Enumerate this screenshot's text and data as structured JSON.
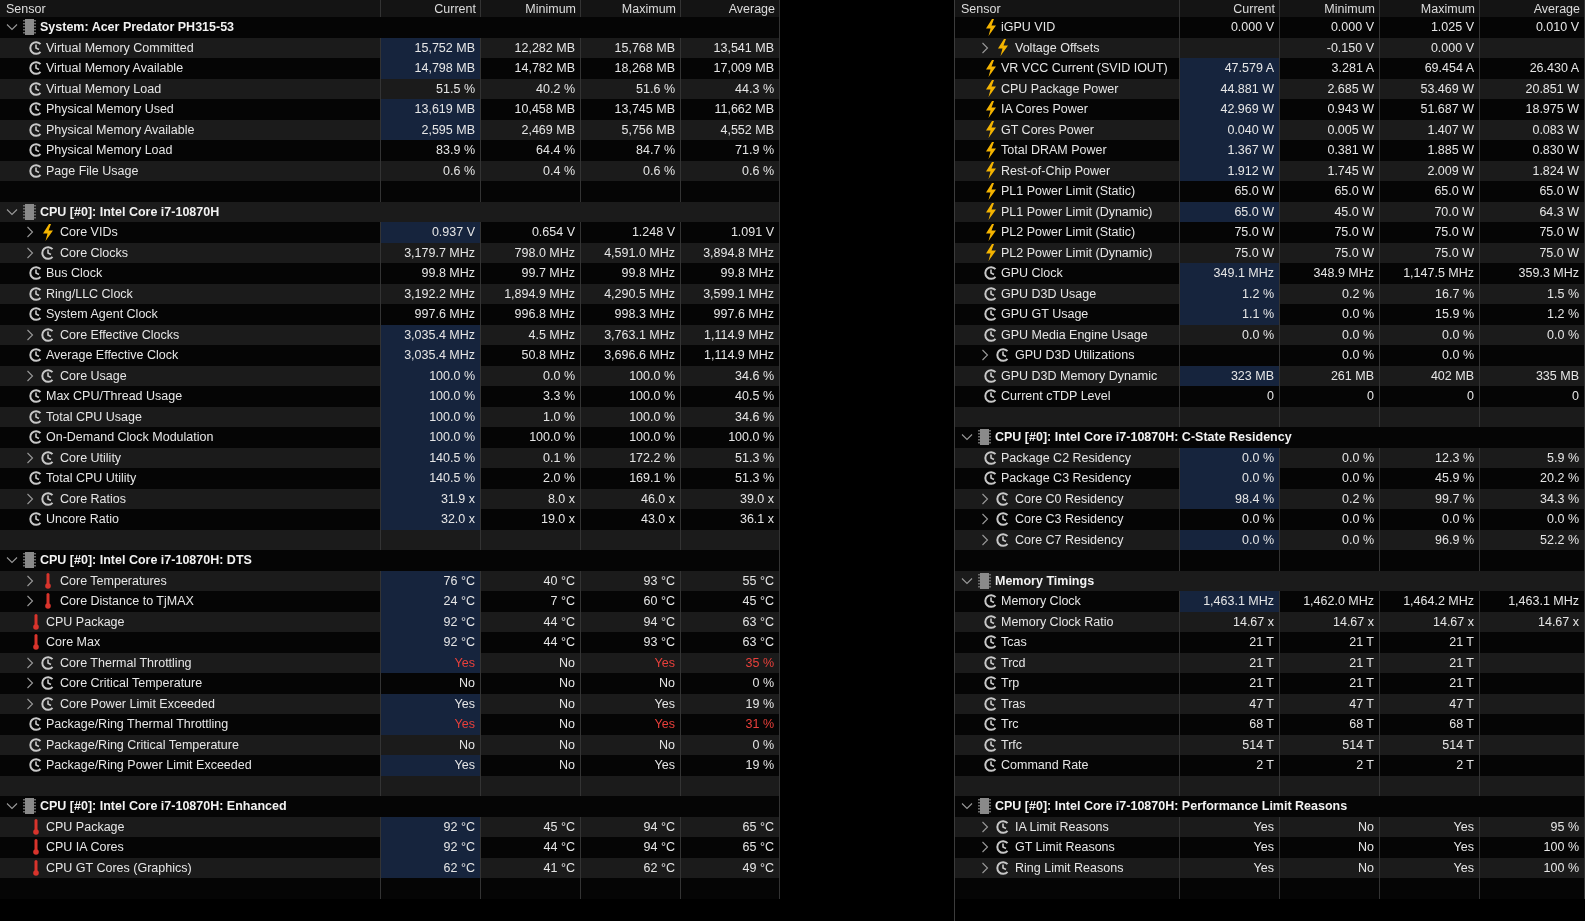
{
  "left_panel": {
    "columns": [
      "Sensor",
      "Current",
      "Minimum",
      "Maximum",
      "Average"
    ],
    "groups": [
      {
        "title": "System: Acer Predator PH315-53",
        "expanded": true,
        "sensors": [
          {
            "label": "Virtual Memory Committed",
            "kind": "clock",
            "expandable": false,
            "highlighted": true,
            "current": "15,752 MB",
            "minimum": "12,282 MB",
            "maximum": "15,768 MB",
            "average": "13,541 MB"
          },
          {
            "label": "Virtual Memory Available",
            "kind": "clock",
            "expandable": false,
            "highlighted": true,
            "current": "14,798 MB",
            "minimum": "14,782 MB",
            "maximum": "18,268 MB",
            "average": "17,009 MB"
          },
          {
            "label": "Virtual Memory Load",
            "kind": "clock",
            "expandable": false,
            "highlighted": false,
            "current": "51.5 %",
            "minimum": "40.2 %",
            "maximum": "51.6 %",
            "average": "44.3 %"
          },
          {
            "label": "Physical Memory Used",
            "kind": "clock",
            "expandable": false,
            "highlighted": true,
            "current": "13,619 MB",
            "minimum": "10,458 MB",
            "maximum": "13,745 MB",
            "average": "11,662 MB"
          },
          {
            "label": "Physical Memory Available",
            "kind": "clock",
            "expandable": false,
            "highlighted": true,
            "current": "2,595 MB",
            "minimum": "2,469 MB",
            "maximum": "5,756 MB",
            "average": "4,552 MB"
          },
          {
            "label": "Physical Memory Load",
            "kind": "clock",
            "expandable": false,
            "highlighted": false,
            "current": "83.9 %",
            "minimum": "64.4 %",
            "maximum": "84.7 %",
            "average": "71.9 %"
          },
          {
            "label": "Page File Usage",
            "kind": "clock",
            "expandable": false,
            "highlighted": false,
            "current": "0.6 %",
            "minimum": "0.4 %",
            "maximum": "0.6 %",
            "average": "0.6 %"
          }
        ]
      },
      {
        "title": "CPU [#0]: Intel Core i7-10870H",
        "expanded": true,
        "sensors": [
          {
            "label": "Core VIDs",
            "kind": "bolt",
            "expandable": true,
            "highlighted": true,
            "current": "0.937 V",
            "minimum": "0.654 V",
            "maximum": "1.248 V",
            "average": "1.091 V"
          },
          {
            "label": "Core Clocks",
            "kind": "clock",
            "expandable": true,
            "highlighted": false,
            "current": "3,179.7 MHz",
            "minimum": "798.0 MHz",
            "maximum": "4,591.0 MHz",
            "average": "3,894.8 MHz"
          },
          {
            "label": "Bus Clock",
            "kind": "clock",
            "expandable": false,
            "highlighted": false,
            "current": "99.8 MHz",
            "minimum": "99.7 MHz",
            "maximum": "99.8 MHz",
            "average": "99.8 MHz"
          },
          {
            "label": "Ring/LLC Clock",
            "kind": "clock",
            "expandable": false,
            "highlighted": false,
            "current": "3,192.2 MHz",
            "minimum": "1,894.9 MHz",
            "maximum": "4,290.5 MHz",
            "average": "3,599.1 MHz"
          },
          {
            "label": "System Agent Clock",
            "kind": "clock",
            "expandable": false,
            "highlighted": false,
            "current": "997.6 MHz",
            "minimum": "996.8 MHz",
            "maximum": "998.3 MHz",
            "average": "997.6 MHz"
          },
          {
            "label": "Core Effective Clocks",
            "kind": "clock",
            "expandable": true,
            "highlighted": true,
            "current": "3,035.4 MHz",
            "minimum": "4.5 MHz",
            "maximum": "3,763.1 MHz",
            "average": "1,114.9 MHz"
          },
          {
            "label": "Average Effective Clock",
            "kind": "clock",
            "expandable": false,
            "highlighted": true,
            "current": "3,035.4 MHz",
            "minimum": "50.8 MHz",
            "maximum": "3,696.6 MHz",
            "average": "1,114.9 MHz"
          },
          {
            "label": "Core Usage",
            "kind": "clock",
            "expandable": true,
            "highlighted": true,
            "current": "100.0 %",
            "minimum": "0.0 %",
            "maximum": "100.0 %",
            "average": "34.6 %"
          },
          {
            "label": "Max CPU/Thread Usage",
            "kind": "clock",
            "expandable": false,
            "highlighted": true,
            "current": "100.0 %",
            "minimum": "3.3 %",
            "maximum": "100.0 %",
            "average": "40.5 %"
          },
          {
            "label": "Total CPU Usage",
            "kind": "clock",
            "expandable": false,
            "highlighted": true,
            "current": "100.0 %",
            "minimum": "1.0 %",
            "maximum": "100.0 %",
            "average": "34.6 %"
          },
          {
            "label": "On-Demand Clock Modulation",
            "kind": "clock",
            "expandable": false,
            "highlighted": true,
            "current": "100.0 %",
            "minimum": "100.0 %",
            "maximum": "100.0 %",
            "average": "100.0 %"
          },
          {
            "label": "Core Utility",
            "kind": "clock",
            "expandable": true,
            "highlighted": true,
            "current": "140.5 %",
            "minimum": "0.1 %",
            "maximum": "172.2 %",
            "average": "51.3 %"
          },
          {
            "label": "Total CPU Utility",
            "kind": "clock",
            "expandable": false,
            "highlighted": true,
            "current": "140.5 %",
            "minimum": "2.0 %",
            "maximum": "169.1 %",
            "average": "51.3 %"
          },
          {
            "label": "Core Ratios",
            "kind": "clock",
            "expandable": true,
            "highlighted": true,
            "current": "31.9 x",
            "minimum": "8.0 x",
            "maximum": "46.0 x",
            "average": "39.0 x"
          },
          {
            "label": "Uncore Ratio",
            "kind": "clock",
            "expandable": false,
            "highlighted": true,
            "current": "32.0 x",
            "minimum": "19.0 x",
            "maximum": "43.0 x",
            "average": "36.1 x"
          }
        ]
      },
      {
        "title": "CPU [#0]: Intel Core i7-10870H: DTS",
        "expanded": true,
        "sensors": [
          {
            "label": "Core Temperatures",
            "kind": "thermometer",
            "expandable": true,
            "highlighted": true,
            "current": "76 °C",
            "minimum": "40 °C",
            "maximum": "93 °C",
            "average": "55 °C"
          },
          {
            "label": "Core Distance to TjMAX",
            "kind": "thermometer",
            "expandable": true,
            "highlighted": true,
            "current": "24 °C",
            "minimum": "7 °C",
            "maximum": "60 °C",
            "average": "45 °C"
          },
          {
            "label": "CPU Package",
            "kind": "thermometer",
            "expandable": false,
            "highlighted": true,
            "current": "92 °C",
            "minimum": "44 °C",
            "maximum": "94 °C",
            "average": "63 °C"
          },
          {
            "label": "Core Max",
            "kind": "thermometer",
            "expandable": false,
            "highlighted": true,
            "current": "92 °C",
            "minimum": "44 °C",
            "maximum": "93 °C",
            "average": "63 °C"
          },
          {
            "label": "Core Thermal Throttling",
            "kind": "clock",
            "expandable": true,
            "highlighted": true,
            "current": "Yes",
            "minimum": "No",
            "maximum": "Yes",
            "average": "35 %",
            "alerts": {
              "current": true,
              "minimum": false,
              "maximum": true,
              "average": true
            }
          },
          {
            "label": "Core Critical Temperature",
            "kind": "clock",
            "expandable": true,
            "highlighted": false,
            "current": "No",
            "minimum": "No",
            "maximum": "No",
            "average": "0 %"
          },
          {
            "label": "Core Power Limit Exceeded",
            "kind": "clock",
            "expandable": true,
            "highlighted": true,
            "current": "Yes",
            "minimum": "No",
            "maximum": "Yes",
            "average": "19 %"
          },
          {
            "label": "Package/Ring Thermal Throttling",
            "kind": "clock",
            "expandable": false,
            "highlighted": true,
            "current": "Yes",
            "minimum": "No",
            "maximum": "Yes",
            "average": "31 %",
            "alerts": {
              "current": true,
              "minimum": false,
              "maximum": true,
              "average": true
            }
          },
          {
            "label": "Package/Ring Critical Temperature",
            "kind": "clock",
            "expandable": false,
            "highlighted": false,
            "current": "No",
            "minimum": "No",
            "maximum": "No",
            "average": "0 %"
          },
          {
            "label": "Package/Ring Power Limit Exceeded",
            "kind": "clock",
            "expandable": false,
            "highlighted": true,
            "current": "Yes",
            "minimum": "No",
            "maximum": "Yes",
            "average": "19 %"
          }
        ]
      },
      {
        "title": "CPU [#0]: Intel Core i7-10870H: Enhanced",
        "expanded": true,
        "sensors": [
          {
            "label": "CPU Package",
            "kind": "thermometer",
            "expandable": false,
            "highlighted": true,
            "current": "92 °C",
            "minimum": "45 °C",
            "maximum": "94 °C",
            "average": "65 °C"
          },
          {
            "label": "CPU IA Cores",
            "kind": "thermometer",
            "expandable": false,
            "highlighted": true,
            "current": "92 °C",
            "minimum": "44 °C",
            "maximum": "94 °C",
            "average": "65 °C"
          },
          {
            "label": "CPU GT Cores (Graphics)",
            "kind": "thermometer",
            "expandable": false,
            "highlighted": true,
            "current": "62 °C",
            "minimum": "41 °C",
            "maximum": "62 °C",
            "average": "49 °C"
          }
        ]
      }
    ]
  },
  "right_panel": {
    "columns": [
      "Sensor",
      "Current",
      "Minimum",
      "Maximum",
      "Average"
    ],
    "groups": [
      {
        "sensors": [
          {
            "label": "iGPU VID",
            "kind": "bolt",
            "expandable": false,
            "highlighted": false,
            "current": "0.000 V",
            "minimum": "0.000 V",
            "maximum": "1.025 V",
            "average": "0.010 V"
          },
          {
            "label": "Voltage Offsets",
            "kind": "bolt",
            "expandable": true,
            "highlighted": false,
            "minimum": "-0.150 V",
            "maximum": "0.000 V"
          },
          {
            "label": "VR VCC Current (SVID IOUT)",
            "kind": "bolt",
            "expandable": false,
            "highlighted": true,
            "current": "47.579 A",
            "minimum": "3.281 A",
            "maximum": "69.454 A",
            "average": "26.430 A"
          },
          {
            "label": "CPU Package Power",
            "kind": "bolt",
            "expandable": false,
            "highlighted": true,
            "current": "44.881 W",
            "minimum": "2.685 W",
            "maximum": "53.469 W",
            "average": "20.851 W"
          },
          {
            "label": "IA Cores Power",
            "kind": "bolt",
            "expandable": false,
            "highlighted": true,
            "current": "42.969 W",
            "minimum": "0.943 W",
            "maximum": "51.687 W",
            "average": "18.975 W"
          },
          {
            "label": "GT Cores Power",
            "kind": "bolt",
            "expandable": false,
            "highlighted": true,
            "current": "0.040 W",
            "minimum": "0.005 W",
            "maximum": "1.407 W",
            "average": "0.083 W"
          },
          {
            "label": "Total DRAM Power",
            "kind": "bolt",
            "expandable": false,
            "highlighted": true,
            "current": "1.367 W",
            "minimum": "0.381 W",
            "maximum": "1.885 W",
            "average": "0.830 W"
          },
          {
            "label": "Rest-of-Chip Power",
            "kind": "bolt",
            "expandable": false,
            "highlighted": true,
            "current": "1.912 W",
            "minimum": "1.745 W",
            "maximum": "2.009 W",
            "average": "1.824 W"
          },
          {
            "label": "PL1 Power Limit (Static)",
            "kind": "bolt",
            "expandable": false,
            "highlighted": false,
            "current": "65.0 W",
            "minimum": "65.0 W",
            "maximum": "65.0 W",
            "average": "65.0 W"
          },
          {
            "label": "PL1 Power Limit (Dynamic)",
            "kind": "bolt",
            "expandable": false,
            "highlighted": true,
            "current": "65.0 W",
            "minimum": "45.0 W",
            "maximum": "70.0 W",
            "average": "64.3 W"
          },
          {
            "label": "PL2 Power Limit (Static)",
            "kind": "bolt",
            "expandable": false,
            "highlighted": false,
            "current": "75.0 W",
            "minimum": "75.0 W",
            "maximum": "75.0 W",
            "average": "75.0 W"
          },
          {
            "label": "PL2 Power Limit (Dynamic)",
            "kind": "bolt",
            "expandable": false,
            "highlighted": false,
            "current": "75.0 W",
            "minimum": "75.0 W",
            "maximum": "75.0 W",
            "average": "75.0 W"
          },
          {
            "label": "GPU Clock",
            "kind": "clock",
            "expandable": false,
            "highlighted": true,
            "current": "349.1 MHz",
            "minimum": "348.9 MHz",
            "maximum": "1,147.5 MHz",
            "average": "359.3 MHz"
          },
          {
            "label": "GPU D3D Usage",
            "kind": "clock",
            "expandable": false,
            "highlighted": true,
            "current": "1.2 %",
            "minimum": "0.2 %",
            "maximum": "16.7 %",
            "average": "1.5 %"
          },
          {
            "label": "GPU GT Usage",
            "kind": "clock",
            "expandable": false,
            "highlighted": true,
            "current": "1.1 %",
            "minimum": "0.0 %",
            "maximum": "15.9 %",
            "average": "1.2 %"
          },
          {
            "label": "GPU Media Engine Usage",
            "kind": "clock",
            "expandable": false,
            "highlighted": false,
            "current": "0.0 %",
            "minimum": "0.0 %",
            "maximum": "0.0 %",
            "average": "0.0 %"
          },
          {
            "label": "GPU D3D Utilizations",
            "kind": "clock",
            "expandable": true,
            "highlighted": false,
            "minimum": "0.0 %",
            "maximum": "0.0 %"
          },
          {
            "label": "GPU D3D Memory Dynamic",
            "kind": "clock",
            "expandable": false,
            "highlighted": true,
            "current": "323 MB",
            "minimum": "261 MB",
            "maximum": "402 MB",
            "average": "335 MB"
          },
          {
            "label": "Current cTDP Level",
            "kind": "clock",
            "expandable": false,
            "highlighted": false,
            "current": "0",
            "minimum": "0",
            "maximum": "0",
            "average": "0"
          }
        ]
      },
      {
        "title": "CPU [#0]: Intel Core i7-10870H: C-State Residency",
        "expanded": true,
        "sensors": [
          {
            "label": "Package C2 Residency",
            "kind": "clock",
            "expandable": false,
            "highlighted": true,
            "current": "0.0 %",
            "minimum": "0.0 %",
            "maximum": "12.3 %",
            "average": "5.9 %"
          },
          {
            "label": "Package C3 Residency",
            "kind": "clock",
            "expandable": false,
            "highlighted": true,
            "current": "0.0 %",
            "minimum": "0.0 %",
            "maximum": "45.9 %",
            "average": "20.2 %"
          },
          {
            "label": "Core C0 Residency",
            "kind": "clock",
            "expandable": true,
            "highlighted": true,
            "current": "98.4 %",
            "minimum": "0.2 %",
            "maximum": "99.7 %",
            "average": "34.3 %"
          },
          {
            "label": "Core C3 Residency",
            "kind": "clock",
            "expandable": true,
            "highlighted": false,
            "current": "0.0 %",
            "minimum": "0.0 %",
            "maximum": "0.0 %",
            "average": "0.0 %"
          },
          {
            "label": "Core C7 Residency",
            "kind": "clock",
            "expandable": true,
            "highlighted": true,
            "current": "0.0 %",
            "minimum": "0.0 %",
            "maximum": "96.9 %",
            "average": "52.2 %"
          }
        ]
      },
      {
        "title": "Memory Timings",
        "expanded": true,
        "sensors": [
          {
            "label": "Memory Clock",
            "kind": "clock",
            "expandable": false,
            "highlighted": true,
            "current": "1,463.1 MHz",
            "minimum": "1,462.0 MHz",
            "maximum": "1,464.2 MHz",
            "average": "1,463.1 MHz"
          },
          {
            "label": "Memory Clock Ratio",
            "kind": "clock",
            "expandable": false,
            "highlighted": false,
            "current": "14.67 x",
            "minimum": "14.67 x",
            "maximum": "14.67 x",
            "average": "14.67 x"
          },
          {
            "label": "Tcas",
            "kind": "clock",
            "expandable": false,
            "highlighted": false,
            "current": "21 T",
            "minimum": "21 T",
            "maximum": "21 T"
          },
          {
            "label": "Trcd",
            "kind": "clock",
            "expandable": false,
            "highlighted": false,
            "current": "21 T",
            "minimum": "21 T",
            "maximum": "21 T"
          },
          {
            "label": "Trp",
            "kind": "clock",
            "expandable": false,
            "highlighted": false,
            "current": "21 T",
            "minimum": "21 T",
            "maximum": "21 T"
          },
          {
            "label": "Tras",
            "kind": "clock",
            "expandable": false,
            "highlighted": false,
            "current": "47 T",
            "minimum": "47 T",
            "maximum": "47 T"
          },
          {
            "label": "Trc",
            "kind": "clock",
            "expandable": false,
            "highlighted": false,
            "current": "68 T",
            "minimum": "68 T",
            "maximum": "68 T"
          },
          {
            "label": "Trfc",
            "kind": "clock",
            "expandable": false,
            "highlighted": false,
            "current": "514 T",
            "minimum": "514 T",
            "maximum": "514 T"
          },
          {
            "label": "Command Rate",
            "kind": "clock",
            "expandable": false,
            "highlighted": false,
            "current": "2 T",
            "minimum": "2 T",
            "maximum": "2 T"
          }
        ]
      },
      {
        "title": "CPU [#0]: Intel Core i7-10870H: Performance Limit Reasons",
        "expanded": true,
        "sensors": [
          {
            "label": "IA Limit Reasons",
            "kind": "clock",
            "expandable": true,
            "highlighted": false,
            "current": "Yes",
            "minimum": "No",
            "maximum": "Yes",
            "average": "95 %"
          },
          {
            "label": "GT Limit Reasons",
            "kind": "clock",
            "expandable": true,
            "highlighted": false,
            "current": "Yes",
            "minimum": "No",
            "maximum": "Yes",
            "average": "100 %"
          },
          {
            "label": "Ring Limit Reasons",
            "kind": "clock",
            "expandable": true,
            "highlighted": false,
            "current": "Yes",
            "minimum": "No",
            "maximum": "Yes",
            "average": "100 %"
          }
        ]
      }
    ]
  }
}
